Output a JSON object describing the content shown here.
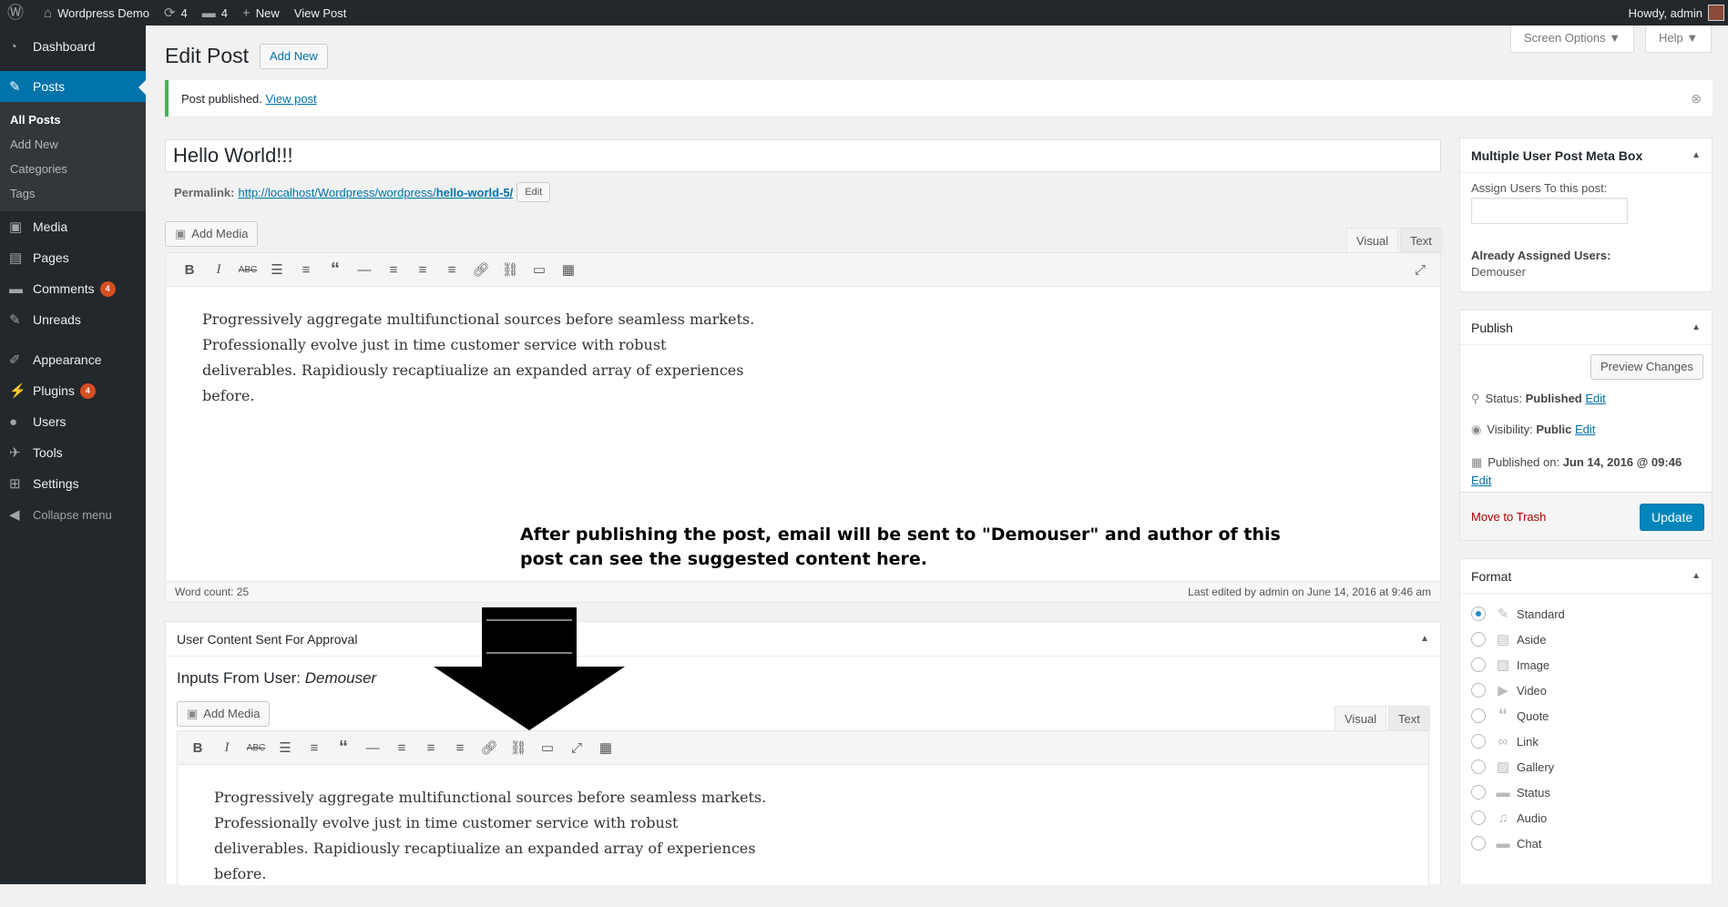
{
  "admin_bar": {
    "site_name": "Wordpress Demo",
    "updates_count": "4",
    "comments_count": "4",
    "new_label": "New",
    "view_post_label": "View Post",
    "howdy": "Howdy, admin"
  },
  "sidebar": {
    "dashboard": "Dashboard",
    "posts": "Posts",
    "posts_sub": [
      "All Posts",
      "Add New",
      "Categories",
      "Tags"
    ],
    "media": "Media",
    "pages": "Pages",
    "comments": "Comments",
    "comments_badge": "4",
    "unreads": "Unreads",
    "appearance": "Appearance",
    "plugins": "Plugins",
    "plugins_badge": "4",
    "users": "Users",
    "tools": "Tools",
    "settings": "Settings",
    "collapse": "Collapse menu"
  },
  "header": {
    "title": "Edit Post",
    "add_new": "Add New",
    "screen_options": "Screen Options ▼",
    "help": "Help ▼"
  },
  "notice": {
    "text": "Post published.",
    "link": "View post"
  },
  "editor": {
    "post_title": "Hello World!!!",
    "permalink_label": "Permalink:",
    "permalink_base": "http://localhost/Wordpress/wordpress/",
    "permalink_slug": "hello-world-5/",
    "permalink_edit": "Edit",
    "add_media": "Add Media",
    "tab_visual": "Visual",
    "tab_text": "Text",
    "content_lines": [
      "Progressively aggregate multifunctional sources before seamless markets.",
      "Professionally evolve just in time customer service with robust",
      "deliverables. Rapidiously recaptiualize an expanded array of experiences",
      "before."
    ],
    "word_count": "Word count: 25",
    "last_edited": "Last edited by admin on June 14, 2016 at 9:46 am"
  },
  "annotation": {
    "line1": "After publishing the post, email will be sent to \"Demouser\" and author of this",
    "line2": "post can see the suggested content here."
  },
  "approval_box": {
    "title": "User Content Sent For Approval",
    "inputs_from": "Inputs From User:",
    "user": "Demouser",
    "add_media": "Add Media",
    "tab_visual": "Visual",
    "tab_text": "Text",
    "content_lines": [
      "Progressively aggregate multifunctional sources before seamless markets.",
      "Professionally evolve just in time customer service with robust",
      "deliverables. Rapidiously recaptiualize an expanded array of experiences",
      "before."
    ]
  },
  "meta_box": {
    "title": "Multiple User Post Meta Box",
    "assign_label": "Assign Users To this post:",
    "assign_value": "",
    "assigned_label": "Already Assigned Users:",
    "assigned_user": "Demouser"
  },
  "publish": {
    "title": "Publish",
    "preview": "Preview Changes",
    "status_label": "Status:",
    "status_value": "Published",
    "visibility_label": "Visibility:",
    "visibility_value": "Public",
    "published_label": "Published on:",
    "published_value": "Jun 14, 2016 @ 09:46",
    "edit": "Edit",
    "trash": "Move to Trash",
    "update": "Update"
  },
  "format": {
    "title": "Format",
    "options": [
      "Standard",
      "Aside",
      "Image",
      "Video",
      "Quote",
      "Link",
      "Gallery",
      "Status",
      "Audio",
      "Chat"
    ],
    "selected": "Standard"
  },
  "colors": {
    "admin_bar": "#23282d",
    "accent": "#0073aa",
    "badge": "#d54e21",
    "notice_border": "#46b450",
    "update_button": "#0085ba"
  }
}
